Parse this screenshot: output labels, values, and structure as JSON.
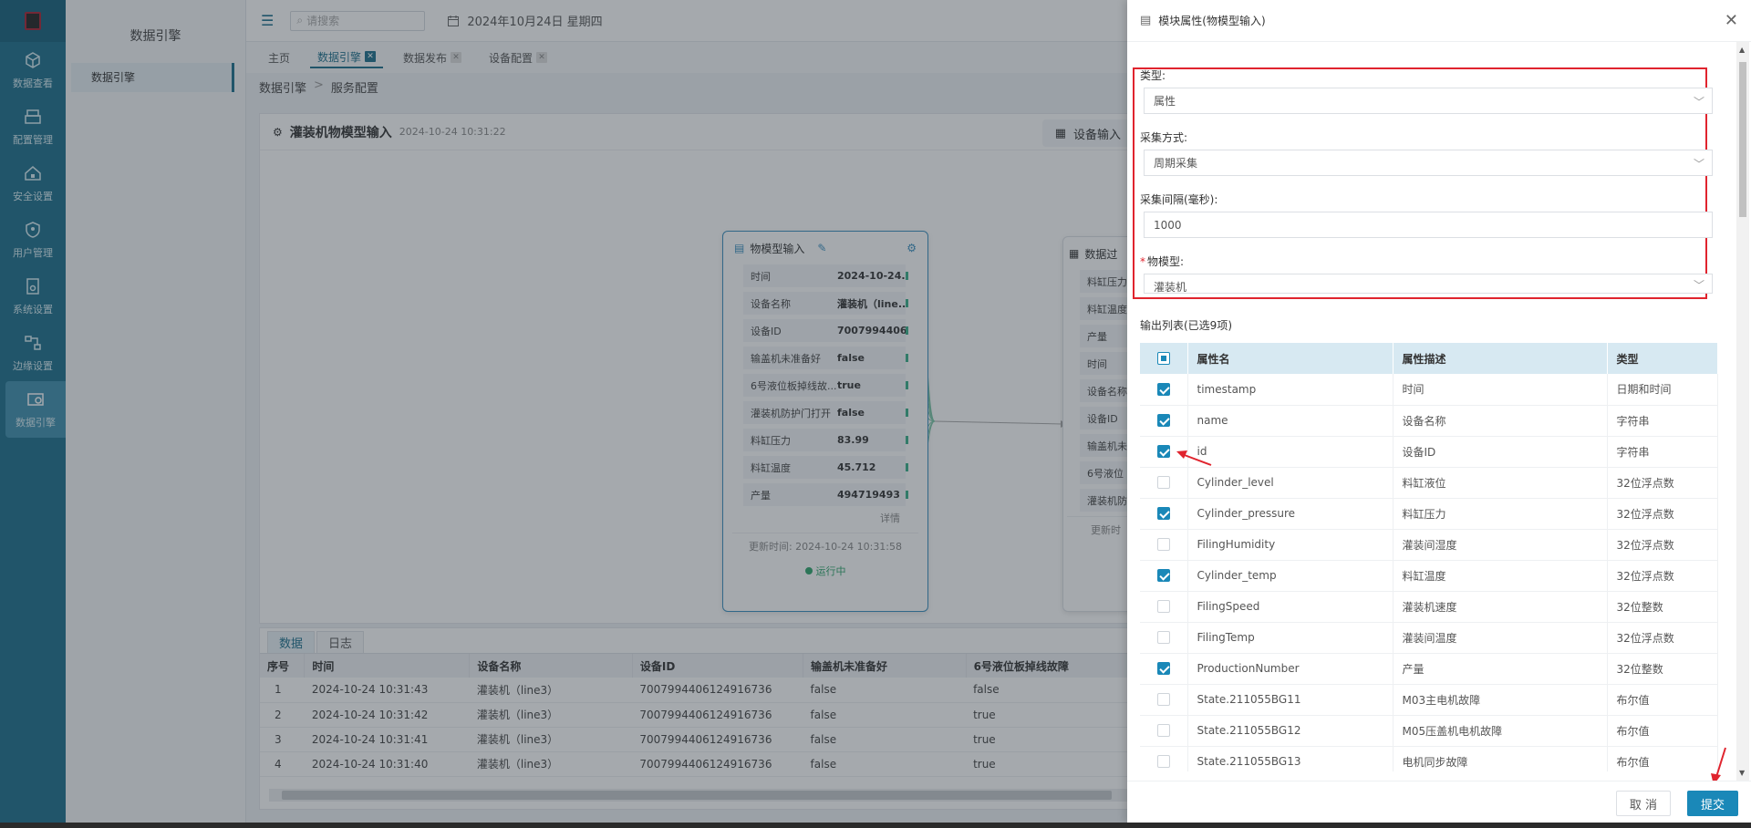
{
  "sidebar": {
    "items": [
      {
        "label": "数据查看",
        "icon": "cube-icon"
      },
      {
        "label": "配置管理",
        "icon": "printer-icon"
      },
      {
        "label": "安全设置",
        "icon": "house-lock-icon"
      },
      {
        "label": "用户管理",
        "icon": "shield-user-icon"
      },
      {
        "label": "系统设置",
        "icon": "document-gear-icon"
      },
      {
        "label": "边缘设置",
        "icon": "flow-icon"
      },
      {
        "label": "数据引擎",
        "icon": "engine-icon"
      }
    ]
  },
  "submenu": {
    "title": "数据引擎",
    "item": "数据引擎"
  },
  "topbar": {
    "search_placeholder": "请搜索",
    "date": "2024年10月24日 星期四"
  },
  "tabs": [
    {
      "label": "主页",
      "closable": false,
      "active": false
    },
    {
      "label": "数据引擎",
      "closable": true,
      "active": true
    },
    {
      "label": "数据发布",
      "closable": true,
      "active": false
    },
    {
      "label": "设备配置",
      "closable": true,
      "active": false
    }
  ],
  "breadcrumb": {
    "root": "数据引擎",
    "separator": ">",
    "current": "服务配置"
  },
  "canvas": {
    "title": "灌装机物模型输入",
    "timestamp": "2024-10-24 10:31:22",
    "device_input_label": "设备输入"
  },
  "node1": {
    "title": "物模型输入",
    "rows": [
      {
        "k": "时间",
        "v": "2024-10-24..."
      },
      {
        "k": "设备名称",
        "v": "灌装机（line..."
      },
      {
        "k": "设备ID",
        "v": "7007994406..."
      },
      {
        "k": "输盖机未准备好",
        "v": "false"
      },
      {
        "k": "6号液位板掉线故...",
        "v": "true"
      },
      {
        "k": "灌装机防护门打开",
        "v": "false"
      },
      {
        "k": "料缸压力",
        "v": "83.99"
      },
      {
        "k": "料缸温度",
        "v": "45.712"
      },
      {
        "k": "产量",
        "v": "494719493"
      }
    ],
    "detail_link": "详情",
    "update_text": "更新时间: 2024-10-24 10:31:58",
    "status": "运行中"
  },
  "node2": {
    "title": "数据过",
    "rows": [
      "料缸压力",
      "料缸温度",
      "产量",
      "时间",
      "设备名称",
      "设备ID",
      "输盖机未",
      "6号液位",
      "灌装机防"
    ],
    "update_text": "更新时"
  },
  "datapanel": {
    "tabs": [
      "数据",
      "日志"
    ],
    "columns": [
      "序号",
      "时间",
      "设备名称",
      "设备ID",
      "输盖机未准备好",
      "6号液位板掉线故障"
    ],
    "rows": [
      [
        "1",
        "2024-10-24 10:31:43",
        "灌装机（line3）",
        "7007994406124916736",
        "false",
        "false"
      ],
      [
        "2",
        "2024-10-24 10:31:42",
        "灌装机（line3）",
        "7007994406124916736",
        "false",
        "true"
      ],
      [
        "3",
        "2024-10-24 10:31:41",
        "灌装机（line3）",
        "7007994406124916736",
        "false",
        "true"
      ],
      [
        "4",
        "2024-10-24 10:31:40",
        "灌装机（line3）",
        "7007994406124916736",
        "false",
        "true"
      ]
    ]
  },
  "drawer": {
    "title": "模块属性(物模型输入)",
    "fields": {
      "type_label": "类型:",
      "type_value": "属性",
      "method_label": "采集方式:",
      "method_value": "周期采集",
      "interval_label": "采集间隔(毫秒):",
      "interval_value": "1000",
      "model_label": "物模型:",
      "model_value": "灌装机"
    },
    "output_title": "输出列表(已选9项)",
    "columns": [
      "属性名",
      "属性描述",
      "类型"
    ],
    "rows": [
      {
        "name": "timestamp",
        "desc": "时间",
        "type": "日期和时间",
        "checked": true
      },
      {
        "name": "name",
        "desc": "设备名称",
        "type": "字符串",
        "checked": true
      },
      {
        "name": "id",
        "desc": "设备ID",
        "type": "字符串",
        "checked": true
      },
      {
        "name": "Cylinder_level",
        "desc": "料缸液位",
        "type": "32位浮点数",
        "checked": false
      },
      {
        "name": "Cylinder_pressure",
        "desc": "料缸压力",
        "type": "32位浮点数",
        "checked": true
      },
      {
        "name": "FilingHumidity",
        "desc": "灌装间湿度",
        "type": "32位浮点数",
        "checked": false
      },
      {
        "name": "Cylinder_temp",
        "desc": "料缸温度",
        "type": "32位浮点数",
        "checked": true
      },
      {
        "name": "FilingSpeed",
        "desc": "灌装机速度",
        "type": "32位整数",
        "checked": false
      },
      {
        "name": "FilingTemp",
        "desc": "灌装间温度",
        "type": "32位浮点数",
        "checked": false
      },
      {
        "name": "ProductionNumber",
        "desc": "产量",
        "type": "32位整数",
        "checked": true
      },
      {
        "name": "State.211055BG11",
        "desc": "M03主电机故障",
        "type": "布尔值",
        "checked": false
      },
      {
        "name": "State.211055BG12",
        "desc": "M05压盖机电机故障",
        "type": "布尔值",
        "checked": false
      },
      {
        "name": "State.211055BG13",
        "desc": "电机同步故障",
        "type": "布尔值",
        "checked": false
      }
    ],
    "cancel_label": "取 消",
    "submit_label": "提交"
  },
  "colors": {
    "accent": "#1a88b8",
    "rail": "#1c6f8c",
    "highlight": "#e0242e"
  }
}
